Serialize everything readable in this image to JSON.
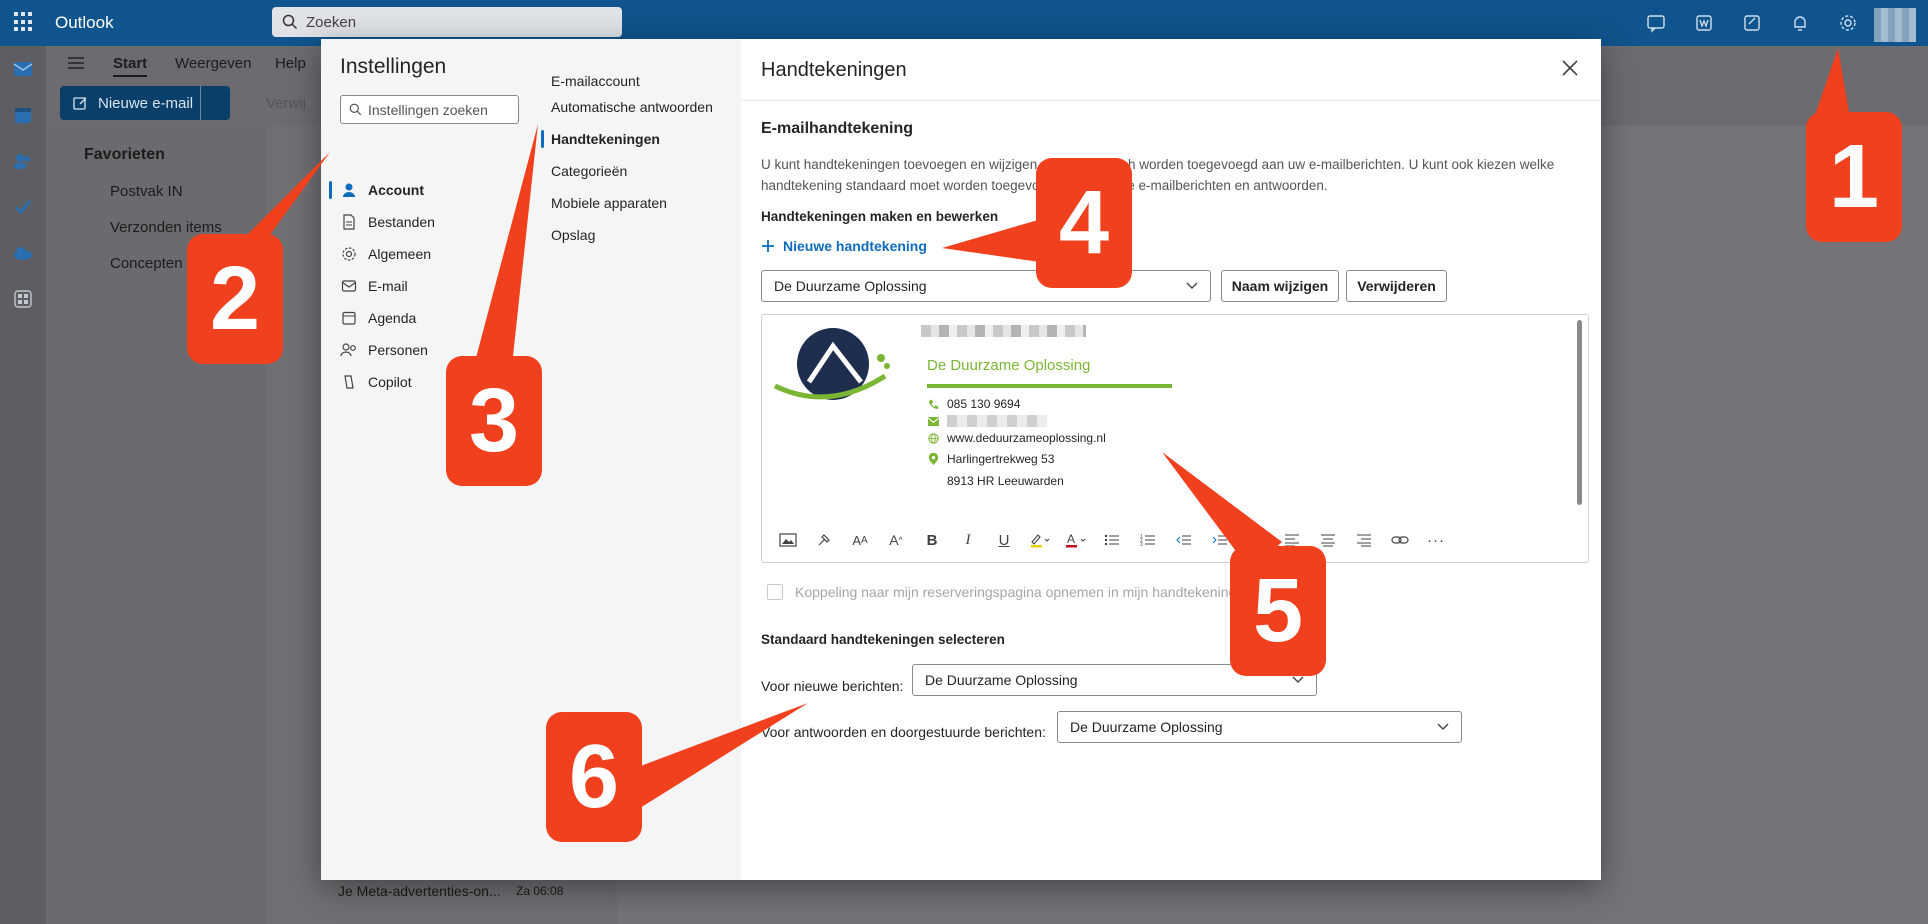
{
  "app": {
    "name": "Outlook",
    "search_placeholder": "Zoeken"
  },
  "ribbon": {
    "tabs": [
      "Start",
      "Weergeven",
      "Help"
    ],
    "new_mail_label": "Nieuwe e-mail",
    "delete_label": "Verwij"
  },
  "folders": {
    "favorites_label": "Favorieten",
    "items": [
      "Postvak IN",
      "Verzonden items",
      "Concepten"
    ]
  },
  "message_list": {
    "last_item_subject": "Je Meta-advertenties-on...",
    "last_item_time": "Za 06:08"
  },
  "settings": {
    "title": "Instellingen",
    "search_placeholder": "Instellingen zoeken",
    "categories": [
      {
        "label": "Account",
        "icon": "person-icon"
      },
      {
        "label": "Bestanden",
        "icon": "file-icon"
      },
      {
        "label": "Algemeen",
        "icon": "gear-icon"
      },
      {
        "label": "E-mail",
        "icon": "mail-icon"
      },
      {
        "label": "Agenda",
        "icon": "calendar-icon"
      },
      {
        "label": "Personen",
        "icon": "people-icon"
      },
      {
        "label": "Copilot",
        "icon": "copilot-icon"
      }
    ],
    "selected_category": "Account",
    "subcategories": [
      "E-mailaccount",
      "Automatische antwoorden",
      "Handtekeningen",
      "Categorieën",
      "Mobiele apparaten",
      "Opslag"
    ],
    "selected_subcategory": "Handtekeningen"
  },
  "signatures": {
    "pane_title": "Handtekeningen",
    "section_title": "E-mailhandtekening",
    "description": "U kunt handtekeningen toevoegen en wijzigen die automatisch worden toegevoegd aan uw e-mailberichten. U kunt ook kiezen welke handtekening standaard moet worden toegevoegd aan nieuwe e-mailberichten en antwoorden.",
    "make_edit_label": "Handtekeningen maken en bewerken",
    "new_signature_label": "Nieuwe handtekening",
    "selected_signature": "De Duurzame Oplossing",
    "rename_label": "Naam wijzigen",
    "delete_label": "Verwijderen",
    "preview": {
      "company": "De Duurzame Oplossing",
      "phone": "085 130 9694",
      "website": "www.deduurzameoplossing.nl",
      "address_line1": "Harlingertrekweg 53",
      "address_line2": "8913 HR Leeuwarden"
    },
    "booking_label": "Koppeling naar mijn reserveringspagina opnemen in mijn handtekening",
    "default_title": "Standaard handtekeningen selecteren",
    "new_messages_label": "Voor nieuwe berichten:",
    "new_messages_value": "De Duurzame Oplossing",
    "replies_label": "Voor antwoorden en doorgestuurde berichten:",
    "replies_value": "De Duurzame Oplossing"
  },
  "callouts": [
    "1",
    "2",
    "3",
    "4",
    "5",
    "6"
  ],
  "colors": {
    "topbar": "#0f548c",
    "accent": "#0f6cbd",
    "callout": "#f0401d",
    "brand_green": "#7ab534"
  }
}
